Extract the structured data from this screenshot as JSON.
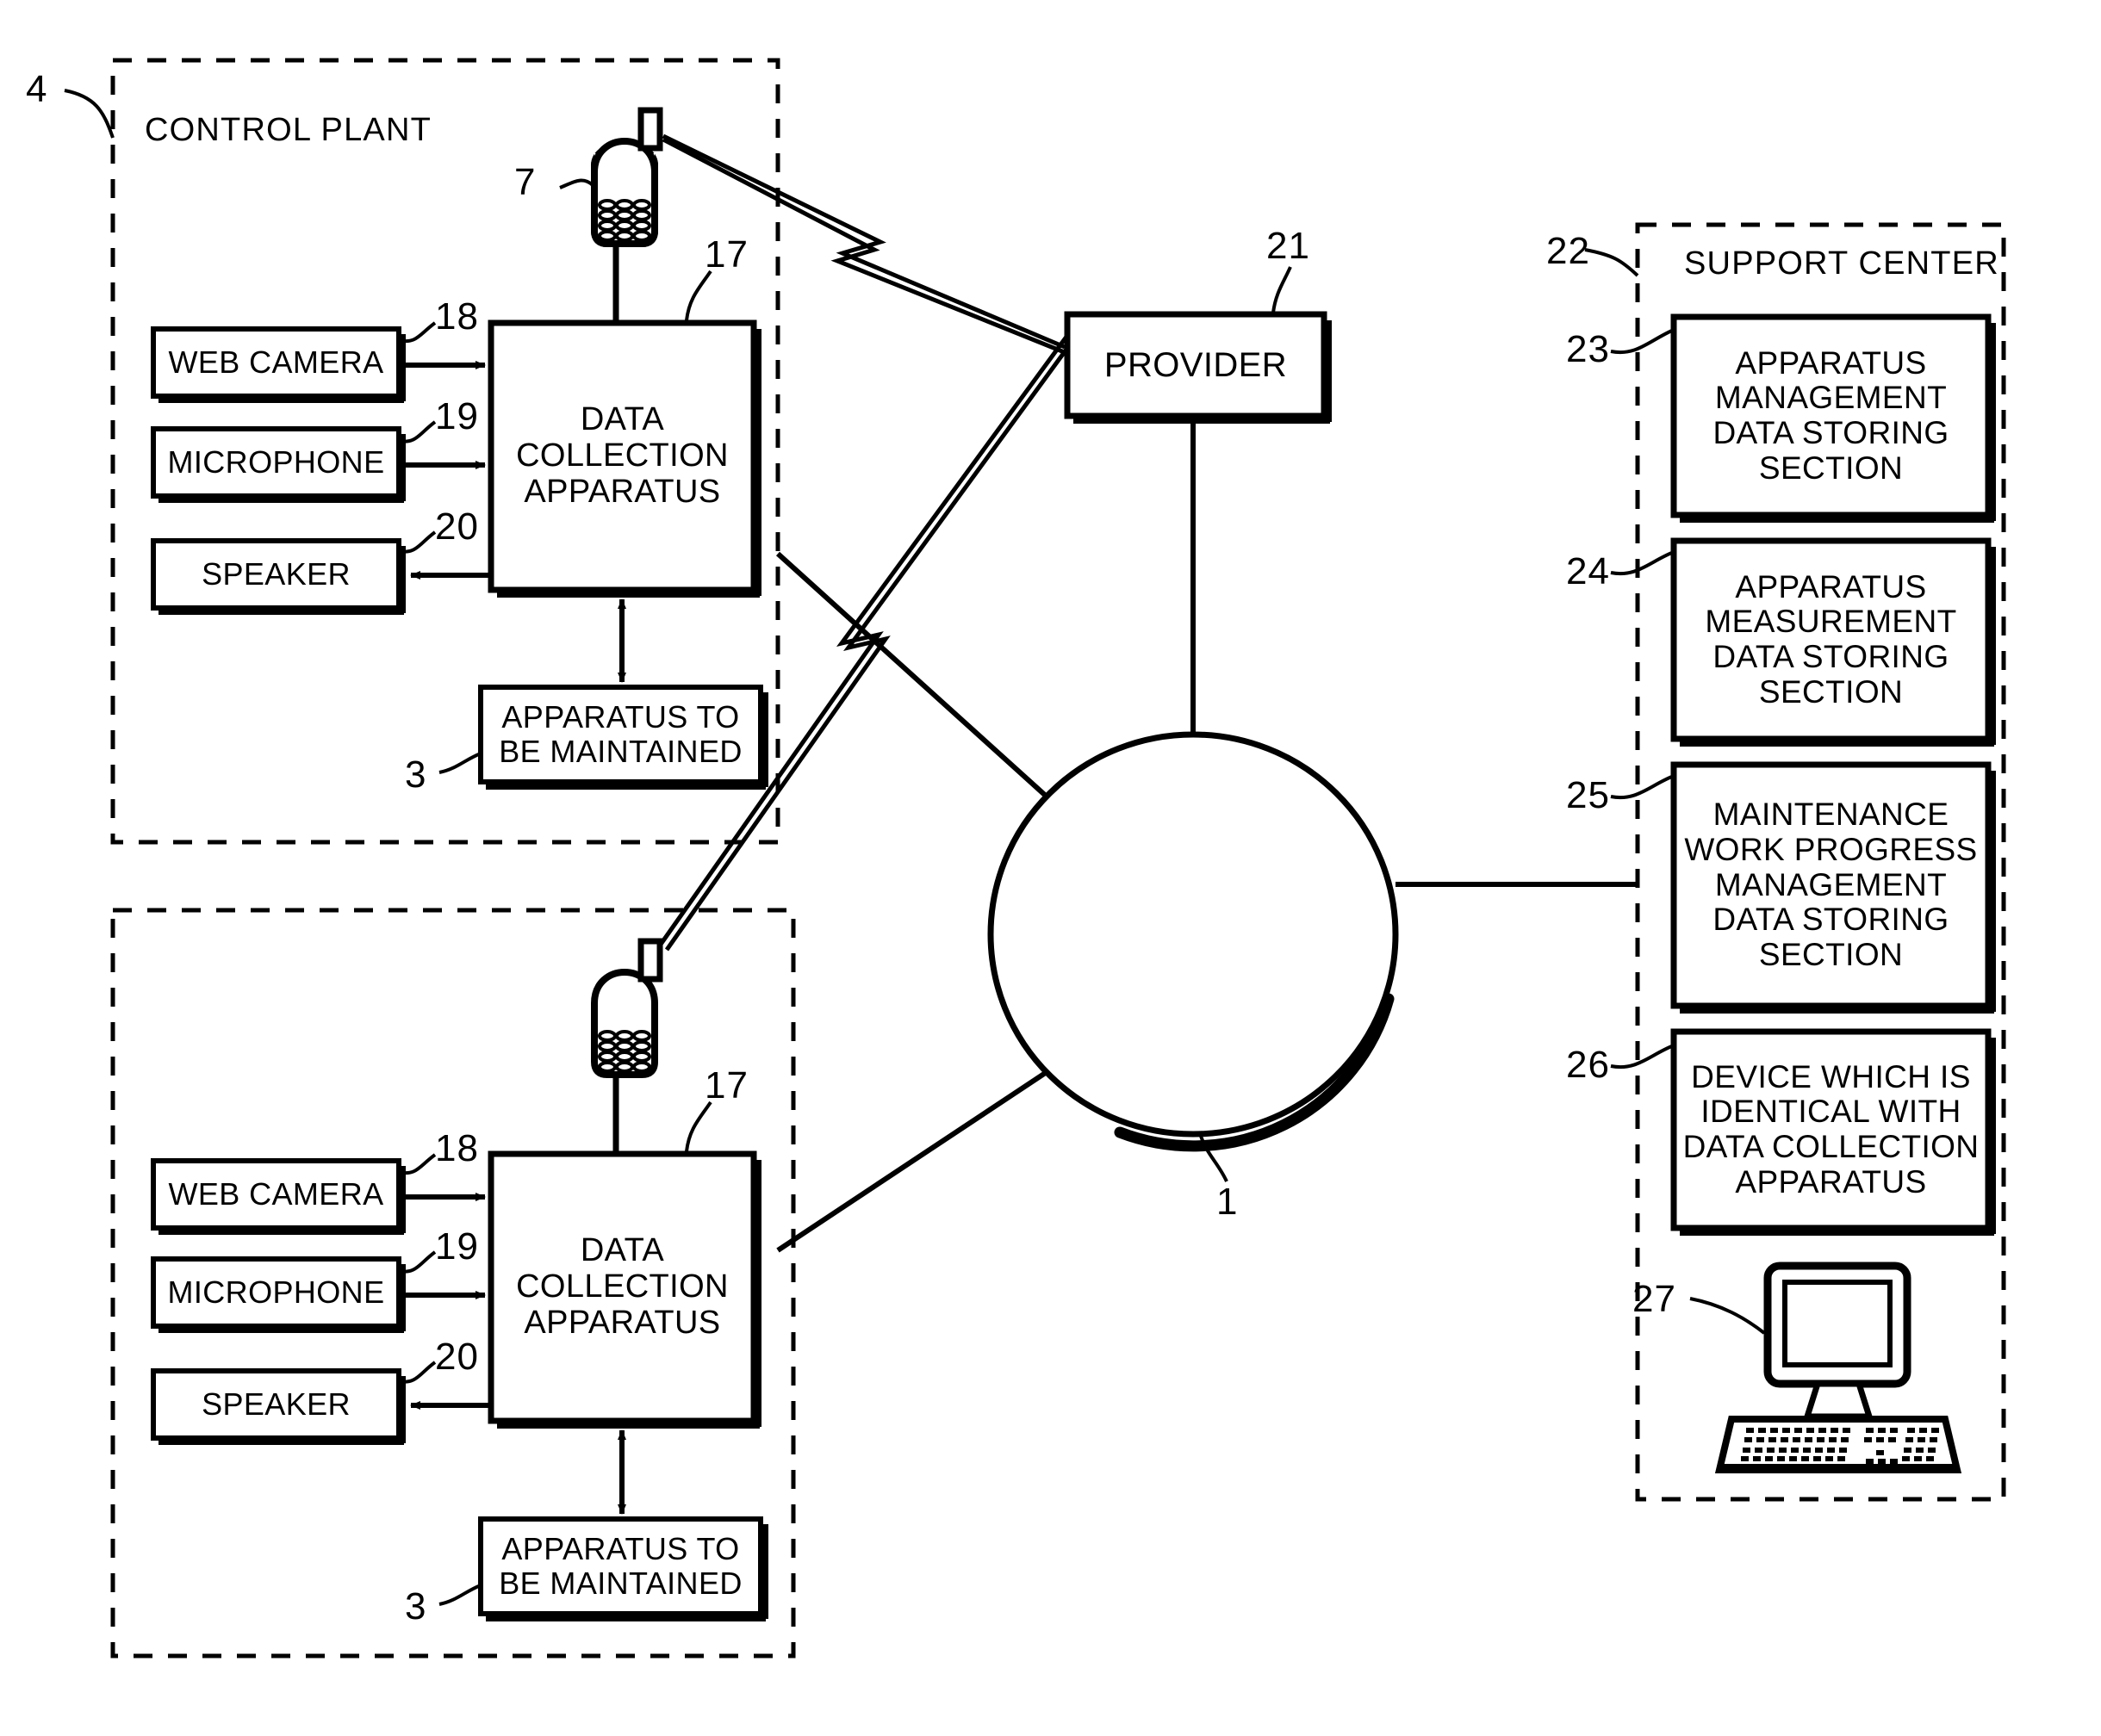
{
  "figure": {
    "type": "patent-block-diagram",
    "background": "#ffffff",
    "line_color": "#000000"
  },
  "zones": [
    {
      "id": "control-plant-upper",
      "ref": "4",
      "title": "CONTROL PLANT",
      "style": "dashed"
    },
    {
      "id": "control-plant-lower",
      "ref": "",
      "title": "",
      "style": "dashed"
    },
    {
      "id": "support-center",
      "ref": "22",
      "title": "SUPPORT CENTER",
      "style": "dashed"
    }
  ],
  "upper_plant": {
    "ref": "4",
    "title": "CONTROL PLANT",
    "web_camera": {
      "label": "WEB CAMERA",
      "ref": "18"
    },
    "microphone": {
      "label": "MICROPHONE",
      "ref": "19"
    },
    "speaker": {
      "label": "SPEAKER",
      "ref": "20"
    },
    "data_collection": {
      "label": "DATA\nCOLLECTION\nAPPARATUS",
      "ref": "17"
    },
    "apparatus_maintained": {
      "label": "APPARATUS TO\nBE MAINTAINED",
      "ref": "3"
    },
    "mobile_phone": {
      "ref": "7",
      "icon": "mobile-phone-icon"
    }
  },
  "lower_plant": {
    "web_camera": {
      "label": "WEB CAMERA",
      "ref": "18"
    },
    "microphone": {
      "label": "MICROPHONE",
      "ref": "19"
    },
    "speaker": {
      "label": "SPEAKER",
      "ref": "20"
    },
    "data_collection": {
      "label": "DATA\nCOLLECTION\nAPPARATUS",
      "ref": "17"
    },
    "apparatus_maintained": {
      "label": "APPARATUS TO\nBE MAINTAINED",
      "ref": "3"
    },
    "mobile_phone": {
      "ref": "",
      "icon": "mobile-phone-icon"
    }
  },
  "provider": {
    "label": "PROVIDER",
    "ref": "21"
  },
  "network": {
    "ref": "1",
    "icon": "network-circle-icon"
  },
  "support_center": {
    "ref": "22",
    "title": "SUPPORT CENTER",
    "sections": [
      {
        "ref": "23",
        "label": "APPARATUS\nMANAGEMENT\nDATA STORING\nSECTION"
      },
      {
        "ref": "24",
        "label": "APPARATUS\nMEASUREMENT\nDATA STORING\nSECTION"
      },
      {
        "ref": "25",
        "label": "MAINTENANCE\nWORK PROGRESS\nMANAGEMENT\nDATA STORING\nSECTION"
      },
      {
        "ref": "26",
        "label": "DEVICE WHICH IS\nIDENTICAL WITH\nDATA COLLECTION\nAPPARATUS"
      }
    ],
    "workstation": {
      "ref": "27",
      "icon": "desktop-computer-icon"
    }
  }
}
